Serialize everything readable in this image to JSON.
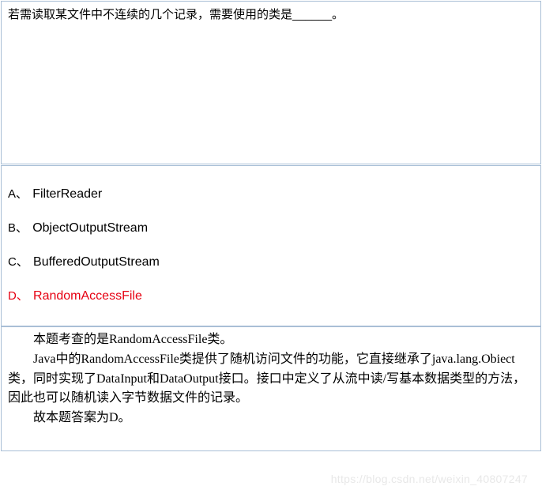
{
  "question": "若需读取某文件中不连续的几个记录，需要使用的类是______。",
  "options": [
    {
      "label": "A、",
      "text": "FilterReader",
      "correct": false
    },
    {
      "label": "B、",
      "text": "ObjectOutputStream",
      "correct": false
    },
    {
      "label": "C、",
      "text": "BufferedOutputStream",
      "correct": false
    },
    {
      "label": "D、",
      "text": "RandomAccessFile",
      "correct": true
    }
  ],
  "explanation": {
    "line1": "本题考查的是RandomAccessFile类。",
    "line2": "Java中的RandomAccessFile类提供了随机访问文件的功能，它直接继承了java.lang.Obiect类，同时实现了DataInput和DataOutput接口。接口中定义了从流中读/写基本数据类型的方法，因此也可以随机读入字节数据文件的记录。",
    "line3": "故本题答案为D。"
  },
  "watermark": "https://blog.csdn.net/weixin_40807247"
}
